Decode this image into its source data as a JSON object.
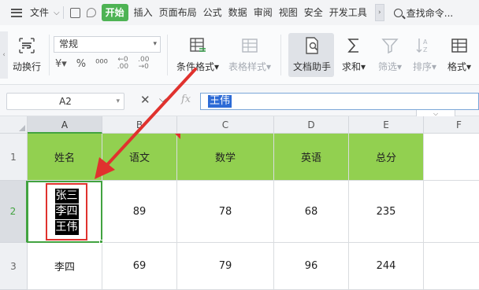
{
  "menubar": {
    "file_label": "文件",
    "start_label": "开始",
    "tabs": [
      "插入",
      "页面布局",
      "公式",
      "数据",
      "审阅",
      "视图",
      "安全",
      "开发工具"
    ],
    "search_label": "查找命令..."
  },
  "ribbon": {
    "wrap_label": "动换行",
    "number_format": "常规",
    "cond_format_label": "条件格式",
    "table_style_label": "表格样式",
    "doc_helper_label": "文档助手",
    "sum_label": "求和",
    "filter_label": "筛选",
    "sort_label": "排序",
    "format_label": "格式"
  },
  "formula_bar": {
    "cell_ref": "A2",
    "fx_label": "fx",
    "content": "王伟"
  },
  "grid": {
    "columns": [
      "A",
      "B",
      "C",
      "D",
      "E",
      "F"
    ],
    "rows": [
      "1",
      "2",
      "3"
    ],
    "header_row": [
      "姓名",
      "语文",
      "数学",
      "英语",
      "总分"
    ],
    "row2": {
      "names": [
        "张三",
        "李四",
        "王伟"
      ],
      "values": [
        "89",
        "78",
        "68",
        "235"
      ]
    },
    "row3": [
      "李四",
      "69",
      "79",
      "96",
      "244"
    ]
  },
  "colors": {
    "header_fill": "#92d050",
    "selection_green": "#42a340",
    "annotation_red": "#e0322e",
    "start_tab": "#4eb354"
  }
}
